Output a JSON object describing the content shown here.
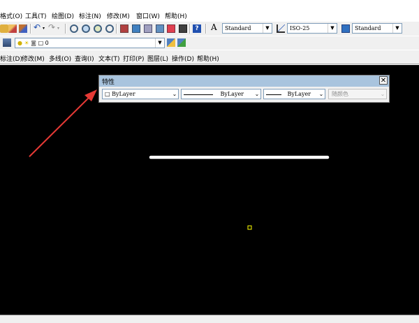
{
  "menubar": {
    "items": [
      "格式(O)",
      "工具(T)",
      "绘图(D)",
      "标注(N)",
      "修改(M)",
      "窗口(W)",
      "帮助(H)"
    ]
  },
  "toolbar1": {
    "text_style": "Standard",
    "dim_style": "ISO-25",
    "table_style": "Standard"
  },
  "toolbar2": {
    "layer": "0"
  },
  "menubar2": {
    "items": [
      "标注(D)",
      "修改(M)",
      "多线(O)",
      "查询(I)",
      "文本(T)",
      "打印(P)",
      "图层(L)",
      "操作(D)",
      "帮助(H)"
    ]
  },
  "properties": {
    "title": "特性",
    "color": "ByLayer",
    "linetype": "ByLayer",
    "lineweight": "ByLayer",
    "plotstyle": "随颜色",
    "close": "✕"
  },
  "colors": {
    "canvas": "#000000",
    "annotation_arrow": "#e53935",
    "line": "#ffffff",
    "marker": "#ffff00",
    "title_bar": "#a9c4de"
  }
}
